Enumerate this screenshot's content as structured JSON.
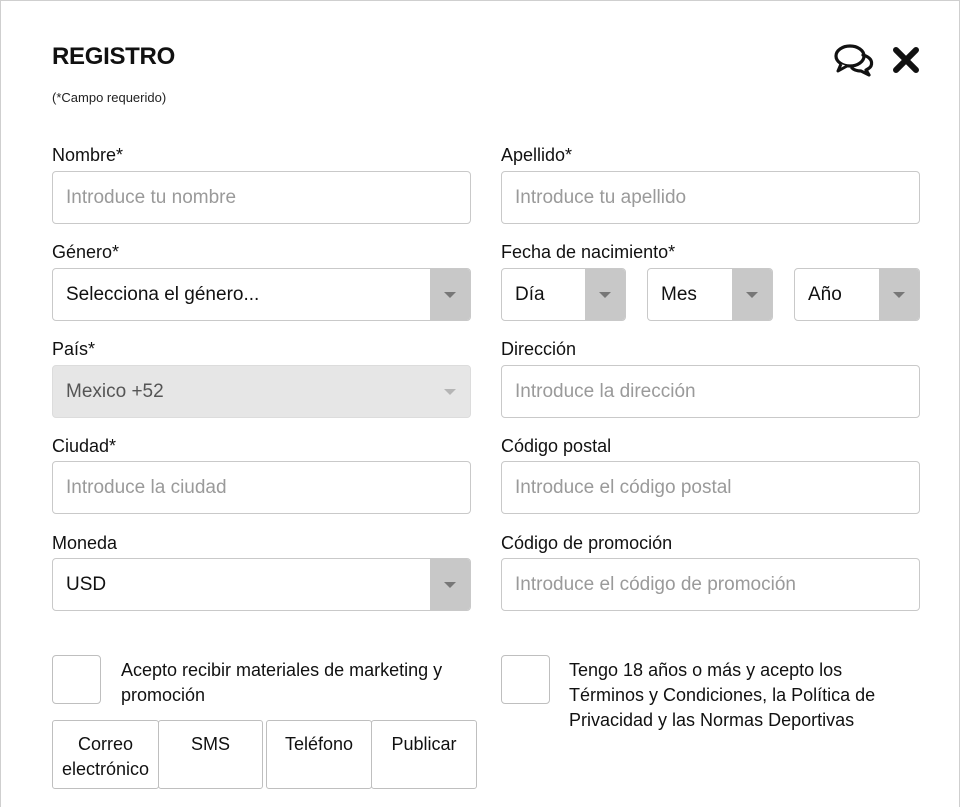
{
  "header": {
    "title": "REGISTRO",
    "required_note": "(*Campo requerido)",
    "chat_icon": "chat-bubbles-icon",
    "close_icon": "close-icon"
  },
  "form": {
    "first_name": {
      "label": "Nombre*",
      "placeholder": "Introduce tu nombre"
    },
    "last_name": {
      "label": "Apellido*",
      "placeholder": "Introduce tu apellido"
    },
    "gender": {
      "label": "Género*",
      "value": "Selecciona el género..."
    },
    "birth_date": {
      "label": "Fecha de nacimiento*",
      "day": "Día",
      "month": "Mes",
      "year": "Año"
    },
    "country": {
      "label": "País*",
      "value": "Mexico +52"
    },
    "address": {
      "label": "Dirección",
      "placeholder": "Introduce la dirección"
    },
    "city": {
      "label": "Ciudad*",
      "placeholder": "Introduce la ciudad"
    },
    "postal_code": {
      "label": "Código postal",
      "placeholder": "Introduce el código postal"
    },
    "currency": {
      "label": "Moneda",
      "value": "USD"
    },
    "promo_code": {
      "label": "Código de promoción",
      "placeholder": "Introduce el código de promoción"
    }
  },
  "consents": {
    "marketing_line1": "Acepto recibir materiales de marketing y",
    "marketing_line2": "promoción",
    "age_line1": "Tengo 18 años o más y acepto los",
    "age_line2": "Términos y Condiciones, la Política de",
    "age_line3": "Privacidad y las Normas Deportivas",
    "channels": {
      "email_line1": "Correo",
      "email_line2": "electrónico",
      "sms": "SMS",
      "phone": "Teléfono",
      "post": "Publicar"
    }
  }
}
